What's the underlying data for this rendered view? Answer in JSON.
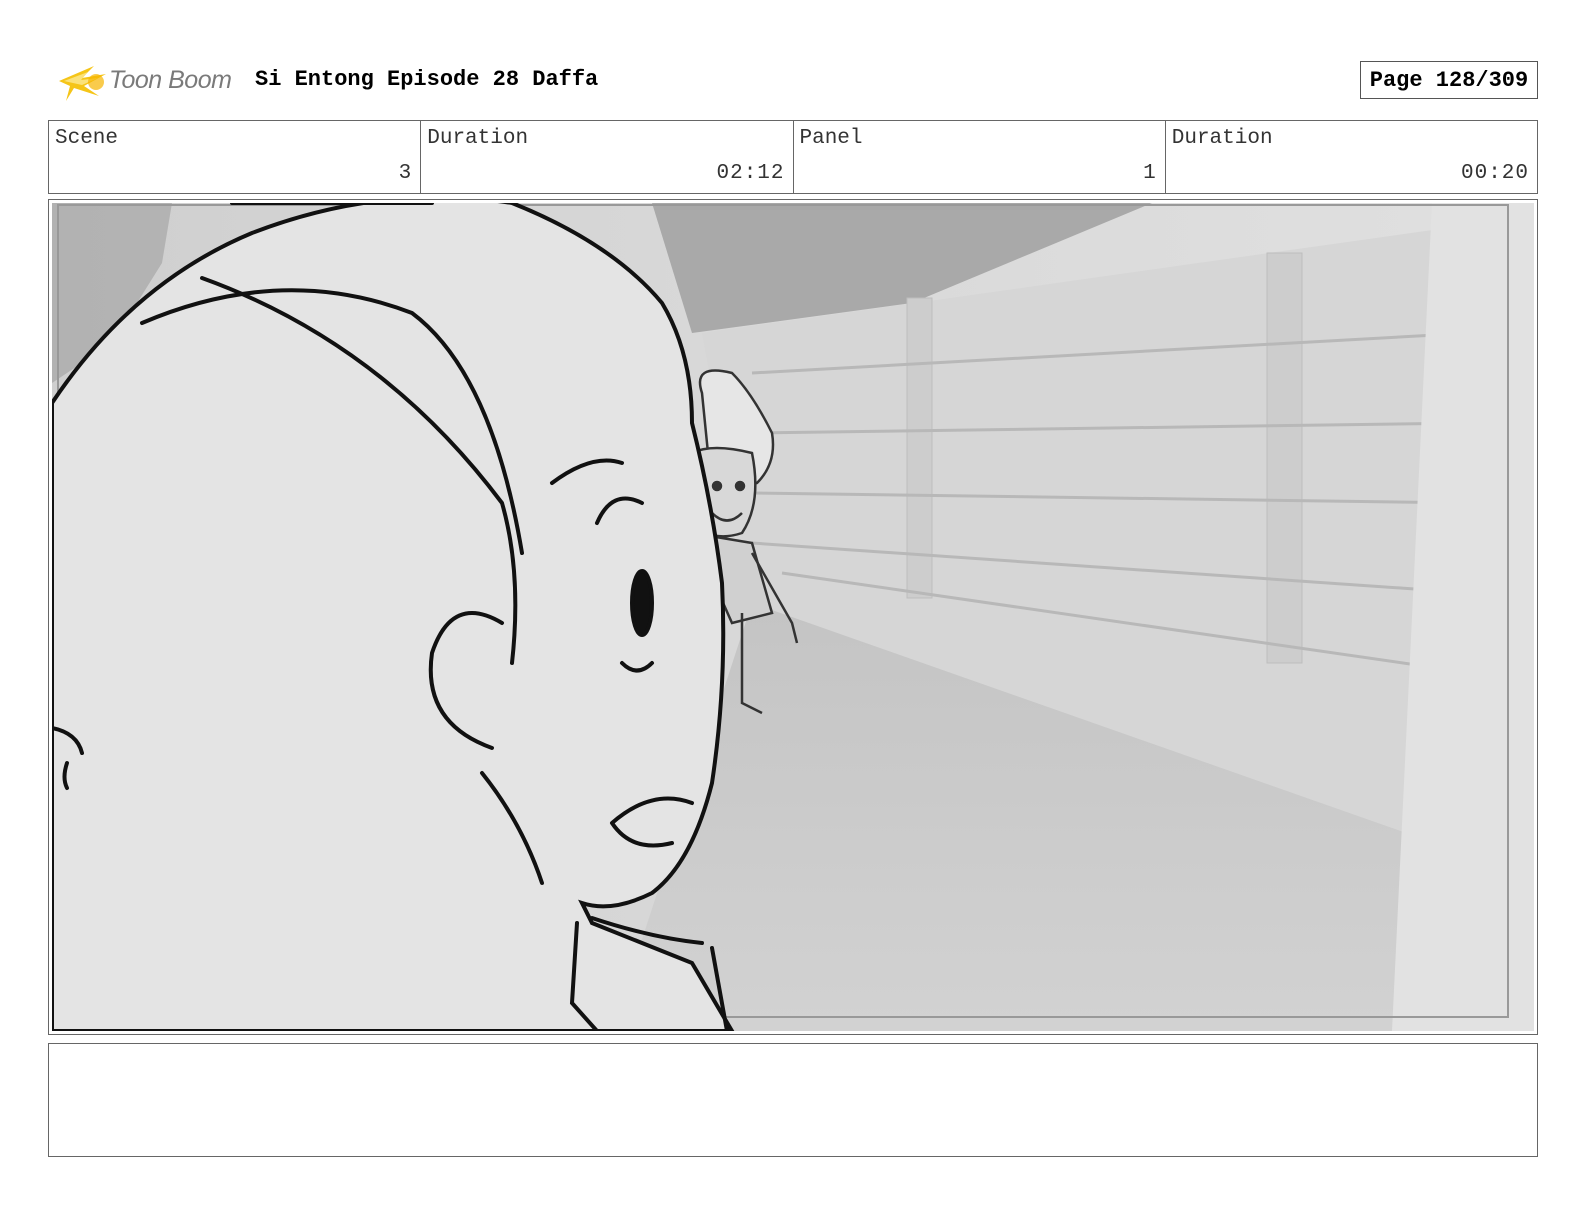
{
  "header": {
    "logo_text": "Toon Boom",
    "title": "Si Entong Episode 28 Daffa",
    "page": "Page 128/309"
  },
  "info": {
    "scene_label": "Scene",
    "scene_value": "3",
    "duration_label": "Duration",
    "duration_value": "02:12",
    "panel_label": "Panel",
    "panel_value": "1",
    "panel_duration_label": "Duration",
    "panel_duration_value": "00:20"
  },
  "notes": {
    "text": ""
  },
  "colors": {
    "logo_flame": "#f5c518",
    "logo_text": "#7a7a7a",
    "border": "#666666"
  }
}
